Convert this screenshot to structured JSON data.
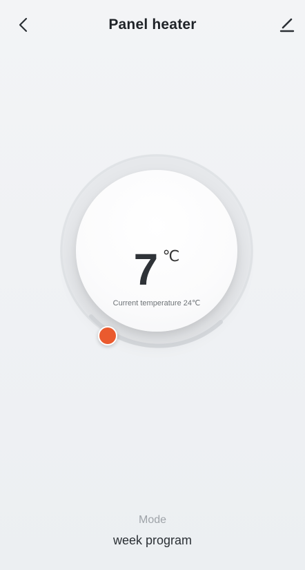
{
  "header": {
    "title": "Panel heater",
    "back_icon": "chevron-left-icon",
    "edit_icon": "pencil-icon"
  },
  "thermostat": {
    "set_temperature": "7",
    "unit": "℃",
    "current_temperature_label": "Current temperature 24℃",
    "knob_color": "#ea5a2e"
  },
  "mode": {
    "label": "Mode",
    "value": "week program"
  }
}
